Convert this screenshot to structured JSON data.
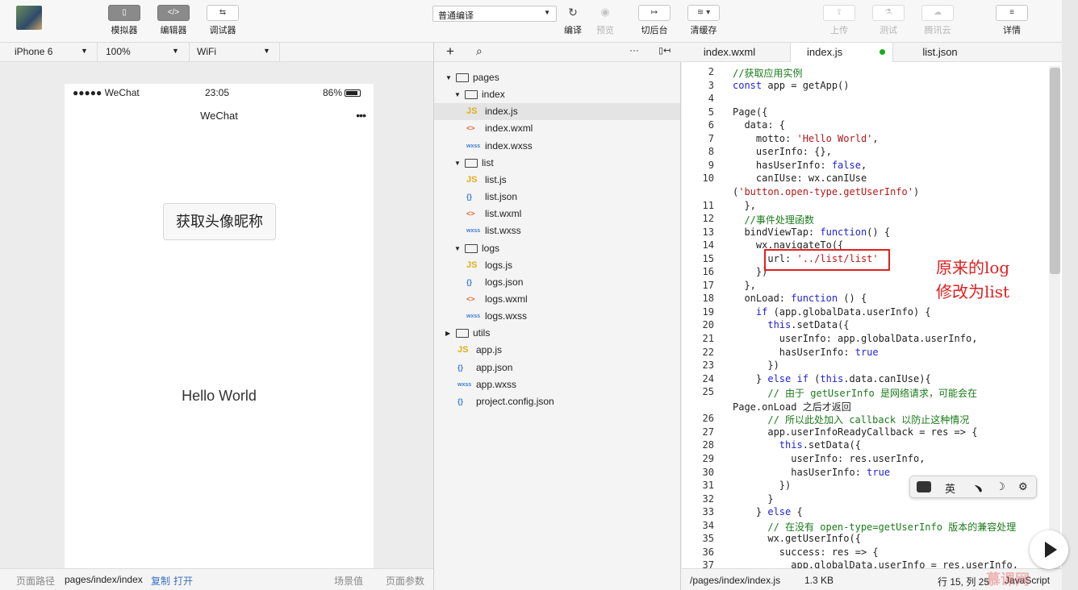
{
  "toolbar": {
    "simulator": "模拟器",
    "editor": "编辑器",
    "debugger": "调试器",
    "compile_mode": "普通编译",
    "compile": "编译",
    "preview": "预览",
    "background": "切后台",
    "clear_cache": "清缓存",
    "upload": "上传",
    "test": "测试",
    "tencent_cloud": "腾讯云",
    "details": "详情"
  },
  "device": {
    "model": "iPhone 6",
    "zoom": "100%",
    "network": "WiFi"
  },
  "phone": {
    "carrier": "●●●●● WeChat",
    "time": "23:05",
    "battery": "86%",
    "nav_title": "WeChat",
    "dots": "•••",
    "user_button": "获取头像昵称",
    "hello": "Hello World"
  },
  "pathbar": {
    "label": "页面路径",
    "path": "pages/index/index",
    "copy": "复制",
    "open": "打开",
    "scene": "场景值",
    "params": "页面参数"
  },
  "tree": [
    {
      "type": "folder",
      "name": "pages",
      "depth": 0,
      "open": true
    },
    {
      "type": "folder",
      "name": "index",
      "depth": 1,
      "open": true
    },
    {
      "type": "js",
      "icon": "JS",
      "name": "index.js",
      "depth": 2,
      "selected": true
    },
    {
      "type": "wxml",
      "icon": "<>",
      "name": "index.wxml",
      "depth": 2
    },
    {
      "type": "wxss",
      "icon": "wxss",
      "name": "index.wxss",
      "depth": 2
    },
    {
      "type": "folder",
      "name": "list",
      "depth": 1,
      "open": true
    },
    {
      "type": "js",
      "icon": "JS",
      "name": "list.js",
      "depth": 2
    },
    {
      "type": "json",
      "icon": "{}",
      "name": "list.json",
      "depth": 2
    },
    {
      "type": "wxml",
      "icon": "<>",
      "name": "list.wxml",
      "depth": 2
    },
    {
      "type": "wxss",
      "icon": "wxss",
      "name": "list.wxss",
      "depth": 2
    },
    {
      "type": "folder",
      "name": "logs",
      "depth": 1,
      "open": true
    },
    {
      "type": "js",
      "icon": "JS",
      "name": "logs.js",
      "depth": 2
    },
    {
      "type": "json",
      "icon": "{}",
      "name": "logs.json",
      "depth": 2
    },
    {
      "type": "wxml",
      "icon": "<>",
      "name": "logs.wxml",
      "depth": 2
    },
    {
      "type": "wxss",
      "icon": "wxss",
      "name": "logs.wxss",
      "depth": 2
    },
    {
      "type": "folder",
      "name": "utils",
      "depth": 0,
      "open": false
    },
    {
      "type": "js",
      "icon": "JS",
      "name": "app.js",
      "depth": 1
    },
    {
      "type": "json",
      "icon": "{}",
      "name": "app.json",
      "depth": 1
    },
    {
      "type": "wxss",
      "icon": "wxss",
      "name": "app.wxss",
      "depth": 1
    },
    {
      "type": "json",
      "icon": "{}",
      "name": "project.config.json",
      "depth": 1
    }
  ],
  "tabs": [
    {
      "name": "index.wxml"
    },
    {
      "name": "index.js",
      "active": true
    },
    {
      "name": "list.json"
    }
  ],
  "code_lines": [
    {
      "n": "2",
      "t": "//获取应用实例"
    },
    {
      "n": "3",
      "t": "const app = getApp()"
    },
    {
      "n": "4",
      "t": ""
    },
    {
      "n": "5",
      "t": "Page({"
    },
    {
      "n": "6",
      "t": "  data: {"
    },
    {
      "n": "7",
      "t": "    motto: 'Hello World',"
    },
    {
      "n": "8",
      "t": "    userInfo: {},"
    },
    {
      "n": "9",
      "t": "    hasUserInfo: false,"
    },
    {
      "n": "10",
      "t": "    canIUse: wx.canIUse"
    },
    {
      "n": "",
      "t": "('button.open-type.getUserInfo')"
    },
    {
      "n": "11",
      "t": "  },"
    },
    {
      "n": "12",
      "t": "  //事件处理函数"
    },
    {
      "n": "13",
      "t": "  bindViewTap: function() {"
    },
    {
      "n": "14",
      "t": "    wx.navigateTo({"
    },
    {
      "n": "15",
      "t": "      url: '../list/list'"
    },
    {
      "n": "16",
      "t": "    })"
    },
    {
      "n": "17",
      "t": "  },"
    },
    {
      "n": "18",
      "t": "  onLoad: function () {"
    },
    {
      "n": "19",
      "t": "    if (app.globalData.userInfo) {"
    },
    {
      "n": "20",
      "t": "      this.setData({"
    },
    {
      "n": "21",
      "t": "        userInfo: app.globalData.userInfo,"
    },
    {
      "n": "22",
      "t": "        hasUserInfo: true"
    },
    {
      "n": "23",
      "t": "      })"
    },
    {
      "n": "24",
      "t": "    } else if (this.data.canIUse){"
    },
    {
      "n": "25",
      "t": "      // 由于 getUserInfo 是网络请求，可能会在"
    },
    {
      "n": "",
      "t": "Page.onLoad 之后才返回"
    },
    {
      "n": "26",
      "t": "      // 所以此处加入 callback 以防止这种情况"
    },
    {
      "n": "27",
      "t": "      app.userInfoReadyCallback = res => {"
    },
    {
      "n": "28",
      "t": "        this.setData({"
    },
    {
      "n": "29",
      "t": "          userInfo: res.userInfo,"
    },
    {
      "n": "30",
      "t": "          hasUserInfo: true"
    },
    {
      "n": "31",
      "t": "        })"
    },
    {
      "n": "32",
      "t": "      }"
    },
    {
      "n": "33",
      "t": "    } else {"
    },
    {
      "n": "34",
      "t": "      // 在没有 open-type=getUserInfo 版本的兼容处理"
    },
    {
      "n": "35",
      "t": "      wx.getUserInfo({"
    },
    {
      "n": "36",
      "t": "        success: res => {"
    },
    {
      "n": "37",
      "t": "          app.globalData.userInfo = res.userInfo,"
    }
  ],
  "annotation": {
    "line1": "原来的log",
    "line2": "修改为list"
  },
  "ime": {
    "lang": "英",
    "punct": "﹅",
    "moon": "☽",
    "gear": "⚙"
  },
  "editor_status": {
    "file": "/pages/index/index.js",
    "size": "1.3 KB",
    "pos": "行 15, 列 25",
    "lang": "JavaScript"
  },
  "watermark": "慕课网"
}
